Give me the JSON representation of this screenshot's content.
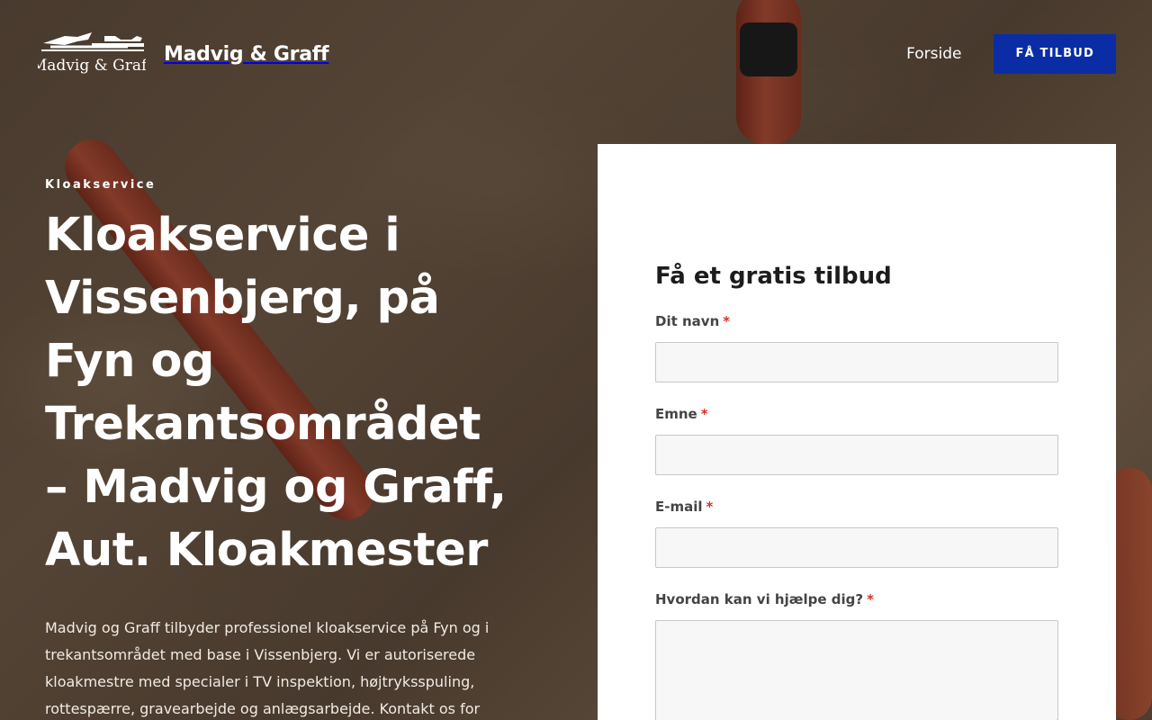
{
  "brand": {
    "logo_lettering": "Madvig & Graff",
    "name": "Madvig & Graff"
  },
  "nav": {
    "home": "Forside",
    "cta": "FÅ TILBUD"
  },
  "hero": {
    "eyebrow": "Kloakservice",
    "title": "Kloakservice i Vissenbjerg, på Fyn og Trekantsområdet – Madvig og Graff, Aut. Kloakmester",
    "description": "Madvig og Graff tilbyder professionel kloakservice på Fyn og i trekantsområdet med base i Vissenbjerg. Vi er autoriserede kloakmestre med specialer i TV inspektion, højtryksspuling, rottespærre, gravearbejde og anlægsarbejde. Kontakt os for"
  },
  "form": {
    "title": "Få et gratis tilbud",
    "required_marker": "*",
    "fields": [
      {
        "label": "Dit navn",
        "value": ""
      },
      {
        "label": "Emne",
        "value": ""
      },
      {
        "label": "E-mail",
        "value": ""
      },
      {
        "label": "Hvordan kan vi hjælpe dig?",
        "value": ""
      }
    ]
  },
  "colors": {
    "cta_background": "#0a2da6",
    "required_marker": "#d93025",
    "pipe": "#c9553a"
  }
}
